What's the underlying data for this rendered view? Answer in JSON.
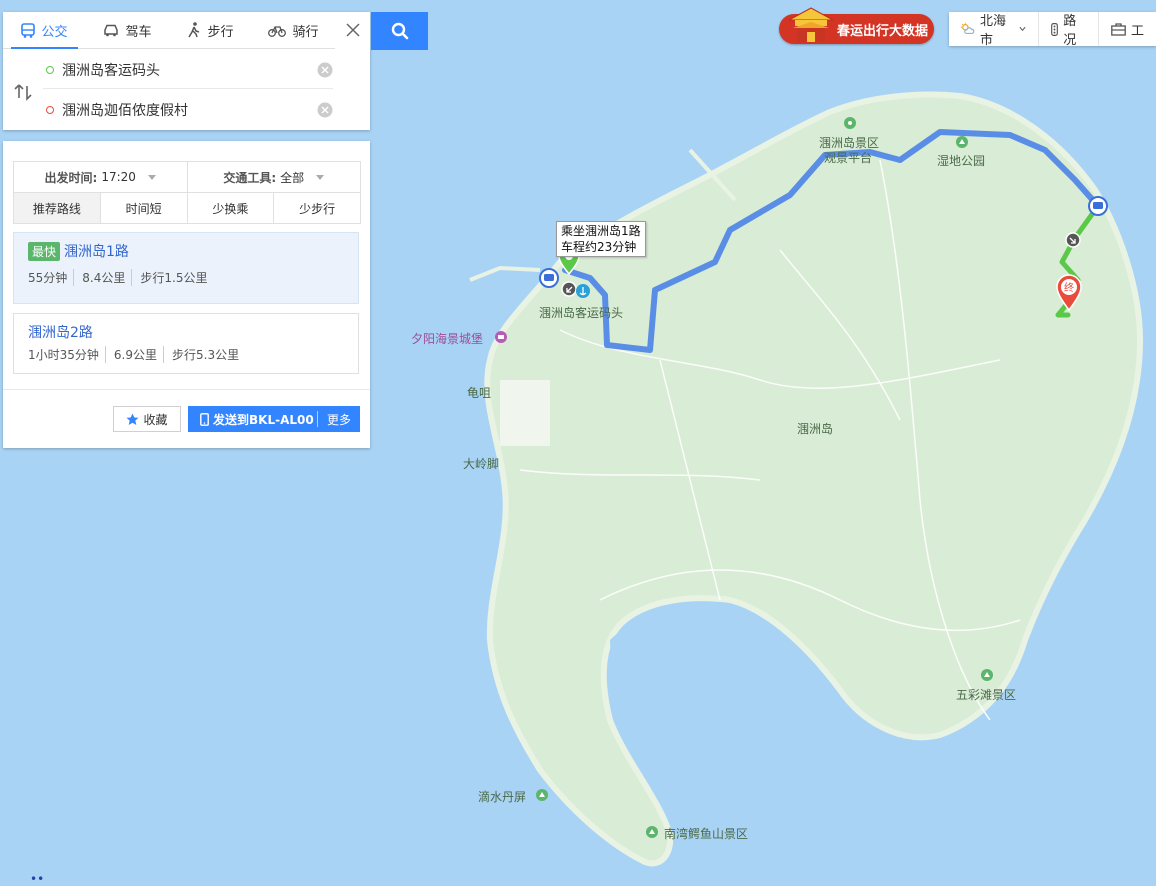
{
  "transport_modes": [
    {
      "label": "公交",
      "icon": "bus-icon",
      "active": true
    },
    {
      "label": "驾车",
      "icon": "car-icon",
      "active": false
    },
    {
      "label": "步行",
      "icon": "walk-icon",
      "active": false
    },
    {
      "label": "骑行",
      "icon": "bike-icon",
      "active": false
    }
  ],
  "search": {
    "origin": "涠洲岛客运码头",
    "destination": "涠洲岛迦佰侬度假村"
  },
  "filters": {
    "depart_label": "出发时间:",
    "depart_value": "17:20",
    "vehicle_label": "交通工具:",
    "vehicle_value": "全部"
  },
  "sort_tabs": [
    "推荐路线",
    "时间短",
    "少换乘",
    "少步行"
  ],
  "routes": [
    {
      "badge": "最快",
      "name": "涠洲岛1路",
      "duration": "55分钟",
      "distance": "8.4公里",
      "walk": "步行1.5公里"
    },
    {
      "badge": "",
      "name": "涠洲岛2路",
      "duration": "1小时35分钟",
      "distance": "6.9公里",
      "walk": "步行5.3公里"
    }
  ],
  "actions": {
    "favorite": "收藏",
    "send": "发送到BKL-AL00",
    "more": "更多"
  },
  "banner": {
    "label": "春运出行大数据"
  },
  "toolbar": {
    "city": "北海市",
    "traffic": "路况",
    "tools": "工"
  },
  "map": {
    "tooltip_line1": "乘坐涠洲岛1路",
    "tooltip_line2": "车程约23分钟",
    "end_marker": "终",
    "labels": {
      "scenic_area": "涠洲岛景区",
      "viewing_platform": "观景平台",
      "wetland_park": "湿地公园",
      "pier": "涠洲岛客运码头",
      "castle": "夕阳海景城堡",
      "guizui": "龟咀",
      "island": "涠洲岛",
      "dalingjiao": "大岭脚",
      "wucaitan": "五彩滩景区",
      "dishuidanping": "滴水丹屏",
      "nanwan": "南湾鳄鱼山景区"
    }
  },
  "colors": {
    "accent": "#3385ff",
    "route_bus": "#5a8ee6",
    "route_walk": "#5cc84a",
    "land": "#d9ecd5",
    "water": "#a9d3f5",
    "end_marker": "#e84c3d"
  }
}
